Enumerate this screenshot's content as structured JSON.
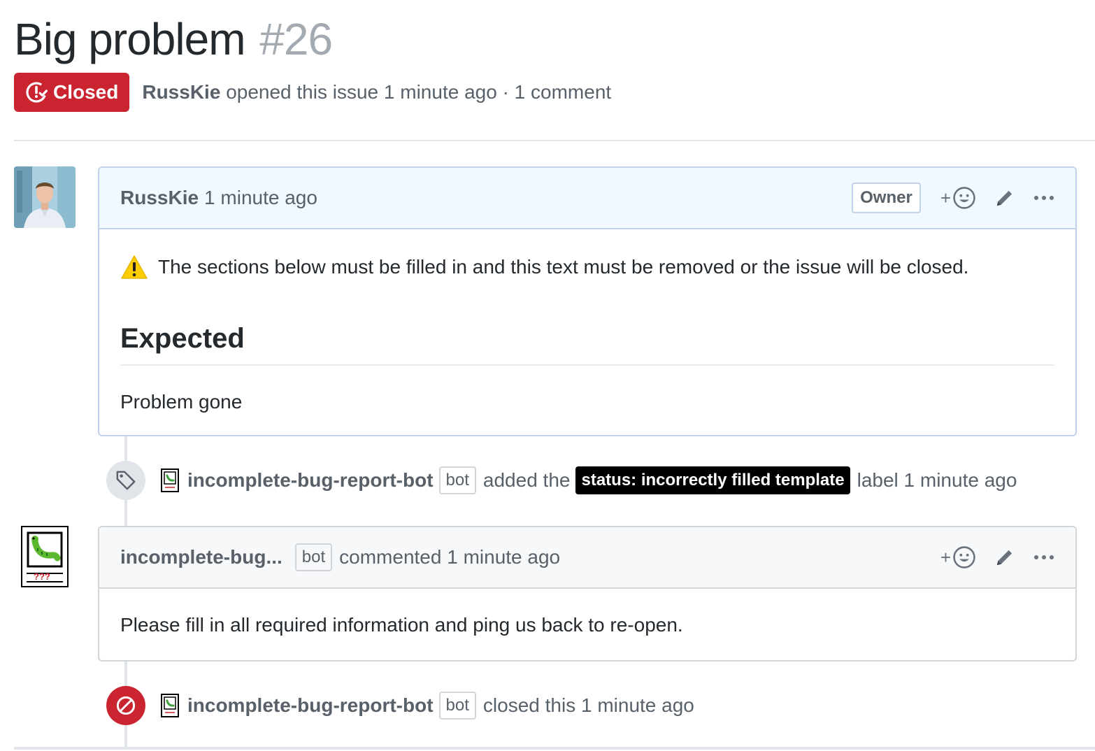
{
  "issue": {
    "title": "Big problem",
    "number": "#26",
    "state": "Closed",
    "author": "RussKie",
    "opened_text": "opened this issue 1 minute ago · 1 comment"
  },
  "comments": [
    {
      "author": "RussKie",
      "time": "1 minute ago",
      "role_badge": "Owner",
      "reaction_plus": "+",
      "body": {
        "warning": "The sections below must be filled in and this text must be removed or the issue will be closed.",
        "heading": "Expected",
        "paragraph": "Problem gone"
      }
    },
    {
      "author": "incomplete-bug...",
      "bot_tag": "bot",
      "action": "commented 1 minute ago",
      "reaction_plus": "+",
      "body": {
        "paragraph": "Please fill in all required information and ping us back to re-open."
      }
    }
  ],
  "events": [
    {
      "type": "labeled",
      "actor": "incomplete-bug-report-bot",
      "bot_tag": "bot",
      "prefix": "added the",
      "label": "status: incorrectly filled template",
      "suffix": "label 1 minute ago"
    },
    {
      "type": "closed",
      "actor": "incomplete-bug-report-bot",
      "bot_tag": "bot",
      "text": "closed this 1 minute ago"
    }
  ],
  "colors": {
    "closed_red": "#cb2431",
    "owner_header_bg": "#f1f8ff",
    "label_bg": "#000000"
  },
  "icons": [
    "issue-closed-icon",
    "smiley-icon",
    "pencil-icon",
    "kebab-icon",
    "tag-icon",
    "circle-slash-icon",
    "warning-icon"
  ]
}
